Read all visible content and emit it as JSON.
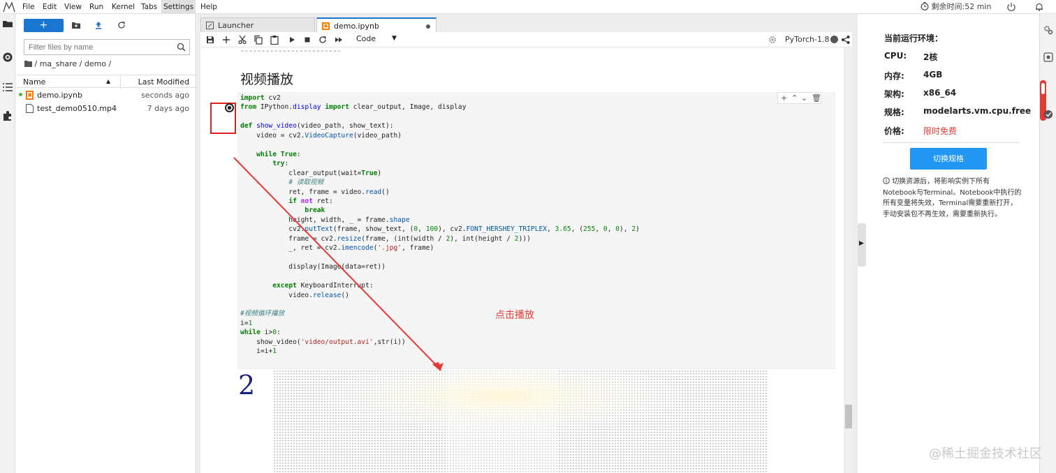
{
  "menubar": {
    "items": [
      "File",
      "Edit",
      "View",
      "Run",
      "Kernel",
      "Tabs",
      "Settings",
      "Help"
    ],
    "timer": "剩余时间:52 min"
  },
  "filebrowser": {
    "new_button": "+",
    "search_placeholder": "Filter files by name",
    "breadcrumb": "/ ma_share / demo /",
    "col_name": "Name",
    "col_modified": "Last Modified",
    "files": [
      {
        "name": "demo.ipynb",
        "modified": "seconds ago"
      },
      {
        "name": "test_demo0510.mp4",
        "modified": "7 days ago"
      }
    ]
  },
  "tabs": {
    "launcher": "Launcher",
    "demo": "demo.ipynb"
  },
  "toolbar": {
    "cell_type": "Code",
    "kernel": "PyTorch-1.8"
  },
  "notebook": {
    "md_underline": "------------------------",
    "heading": "视频播放",
    "annotation": "点击播放",
    "output_text": "2"
  },
  "rightpanel": {
    "title": "当前运行环境：",
    "rows": [
      {
        "label": "CPU:",
        "value": "2核"
      },
      {
        "label": "内存:",
        "value": "4GB"
      },
      {
        "label": "架构:",
        "value": "x86_64"
      },
      {
        "label": "规格:",
        "value": "modelarts.vm.cpu.free"
      },
      {
        "label": "价格:",
        "value": "限时免费"
      }
    ],
    "switch_button": "切换规格",
    "note": "切换资源后，将影响实例下所有Notebook与Terminal。Notebook中执行的所有变量将失效，Terminal需要重新打开，手动安装包不再生效，需要重新执行。"
  },
  "watermark": "@稀土掘金技术社区",
  "colors": {
    "accent": "#1976d2",
    "annotation": "#e53935",
    "button": "#2196f3"
  },
  "icons": [
    "jupyter-logo-icon",
    "folder-icon",
    "running-icon",
    "toc-icon",
    "extension-icon",
    "upload-icon",
    "refresh-icon",
    "search-icon",
    "notebook-file-icon",
    "video-file-icon",
    "save-icon",
    "add-cell-icon",
    "cut-icon",
    "copy-icon",
    "paste-icon",
    "run-icon",
    "stop-icon",
    "restart-icon",
    "fast-forward-icon",
    "settings-icon",
    "share-icon",
    "clock-icon",
    "power-icon",
    "bell-icon"
  ]
}
